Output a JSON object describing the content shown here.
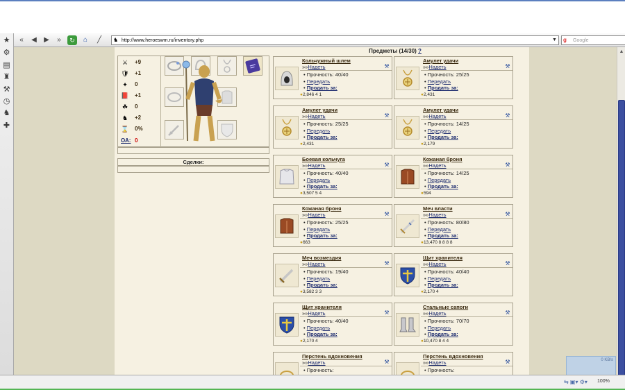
{
  "browser": {
    "url": "http://www.heroeswm.ru/inventory.php",
    "search_placeholder": "Google",
    "zoom": "100%",
    "net_speed": "0 KB/s"
  },
  "stats": [
    {
      "icon": "attack-icon",
      "glyph": "⚔",
      "value": "+9"
    },
    {
      "icon": "defense-icon",
      "glyph": "🛡",
      "value": "+1"
    },
    {
      "icon": "spellpower-icon",
      "glyph": "✦",
      "value": "0"
    },
    {
      "icon": "knowledge-icon",
      "glyph": "📕",
      "value": "+1"
    },
    {
      "icon": "luck-icon",
      "glyph": "☘",
      "value": "0"
    },
    {
      "icon": "morale-icon",
      "glyph": "♞",
      "value": "+2"
    },
    {
      "icon": "initiative-icon",
      "glyph": "⌛",
      "value": "0%"
    }
  ],
  "oa": {
    "label": "ОА:",
    "value": "0"
  },
  "deals_label": "Сделки:",
  "items_header": {
    "title": "Предметы (14/30)",
    "help": "?"
  },
  "ui": {
    "equip_prefix": "»»",
    "equip_label": "Надеть",
    "durability_label": "Прочность:",
    "transfer_label": "Передать",
    "sell_label": "Продать за:"
  },
  "items": [
    {
      "name": "Кольчужный шлем",
      "icon": "chain-helmet-icon",
      "durability": "40/40",
      "price": "2,846",
      "extra": "4  1"
    },
    {
      "name": "Амулет удачи",
      "icon": "luck-amulet-icon",
      "durability": "25/25",
      "price": "2,431",
      "extra": ""
    },
    {
      "name": "Амулет удачи",
      "icon": "luck-amulet-icon",
      "durability": "25/25",
      "price": "2,431",
      "extra": ""
    },
    {
      "name": "Амулет удачи",
      "icon": "luck-amulet-icon",
      "durability": "14/25",
      "price": "2,179",
      "extra": ""
    },
    {
      "name": "Боевая кольчуга",
      "icon": "chainmail-icon",
      "durability": "40/40",
      "price": "3,507",
      "extra": "5  4"
    },
    {
      "name": "Кожаная броня",
      "icon": "leather-armor-icon",
      "durability": "14/25",
      "price": "594",
      "extra": ""
    },
    {
      "name": "Кожаная броня",
      "icon": "leather-armor-icon",
      "durability": "25/25",
      "price": "663",
      "extra": ""
    },
    {
      "name": "Меч власти",
      "icon": "sword-of-power-icon",
      "durability": "80/80",
      "price": "13,470",
      "extra": "8  8  8  8"
    },
    {
      "name": "Меч возмездия",
      "icon": "sword-of-retribution-icon",
      "durability": "19/40",
      "price": "3,582",
      "extra": "3  3"
    },
    {
      "name": "Щит хранителя",
      "icon": "guardian-shield-icon",
      "durability": "40/40",
      "price": "2,170",
      "extra": "4"
    },
    {
      "name": "Щит хранителя",
      "icon": "guardian-shield-icon",
      "durability": "40/40",
      "price": "2,170",
      "extra": "4"
    },
    {
      "name": "Стальные сапоги",
      "icon": "steel-boots-icon",
      "durability": "70/70",
      "price": "10,470",
      "extra": "8  4  4"
    },
    {
      "name": "Перстень вдохновения",
      "icon": "ring-of-inspiration-icon",
      "durability": "",
      "price": "",
      "extra": ""
    },
    {
      "name": "Перстень вдохновения",
      "icon": "ring-of-inspiration-icon",
      "durability": "",
      "price": "",
      "extra": ""
    }
  ]
}
